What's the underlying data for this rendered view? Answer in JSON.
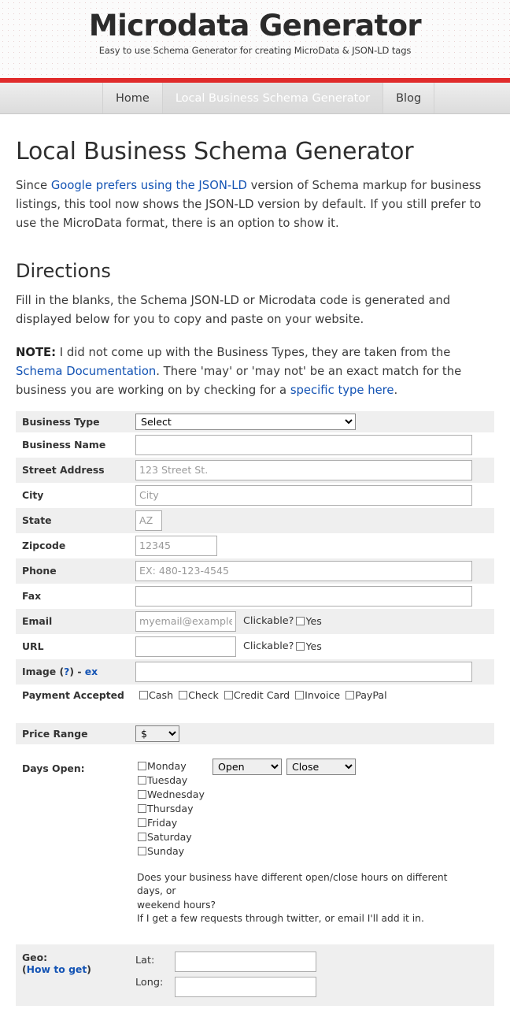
{
  "header": {
    "title": "Microdata Generator",
    "tagline": "Easy to use Schema Generator for creating MicroData & JSON-LD tags",
    "accent_color": "#e02b2b"
  },
  "nav": {
    "items": [
      {
        "label": "Home",
        "active": false
      },
      {
        "label": "Local Business Schema Generator",
        "active": true
      },
      {
        "label": "Blog",
        "active": false
      }
    ]
  },
  "page": {
    "title": "Local Business Schema Generator",
    "intro": {
      "before_link": "Since ",
      "link": "Google prefers using the JSON-LD",
      "after_link": " version of Schema markup for business listings, this tool now shows the JSON-LD version by default. If you still prefer to use the MicroData format, there is an option to show it."
    },
    "directions": {
      "heading": "Directions",
      "paragraph": "Fill in the blanks, the Schema JSON-LD or Microdata code is generated and displayed below for you to copy and paste on your website.",
      "note_label": "NOTE:",
      "note_part1": " I did not come up with the Business Types, they are taken from the ",
      "note_link1": "Schema Documentation",
      "note_part2": ". There 'may' or 'may not' be an exact match for the business you are working on by checking for a ",
      "note_link2": "specific type here",
      "note_part3": "."
    }
  },
  "form": {
    "business_type": {
      "label": "Business Type",
      "value": "Select"
    },
    "business_name": {
      "label": "Business Name",
      "value": "",
      "placeholder": ""
    },
    "street_address": {
      "label": "Street Address",
      "value": "",
      "placeholder": "123 Street St."
    },
    "city": {
      "label": "City",
      "value": "",
      "placeholder": "City"
    },
    "state": {
      "label": "State",
      "value": "",
      "placeholder": "AZ"
    },
    "zipcode": {
      "label": "Zipcode",
      "value": "",
      "placeholder": "12345"
    },
    "phone": {
      "label": "Phone",
      "value": "",
      "placeholder": "EX: 480-123-4545"
    },
    "fax": {
      "label": "Fax",
      "value": "",
      "placeholder": ""
    },
    "email": {
      "label": "Email",
      "value": "",
      "placeholder": "myemail@example.",
      "clickable_label": "Clickable?",
      "clickable_yes": "Yes"
    },
    "url": {
      "label": "URL",
      "value": "",
      "placeholder": "",
      "clickable_label": "Clickable?",
      "clickable_yes": "Yes"
    },
    "image": {
      "label_prefix": "Image (",
      "label_help": "?",
      "label_mid": ") - ",
      "label_ex": "ex",
      "value": "",
      "placeholder": ""
    },
    "payment_accepted": {
      "label": "Payment Accepted",
      "options": [
        "Cash",
        "Check",
        "Credit Card",
        "Invoice",
        "PayPal"
      ]
    },
    "price_range": {
      "label": "Price Range",
      "value": "$"
    },
    "days_open": {
      "label": "Days Open:",
      "days": [
        "Monday",
        "Tuesday",
        "Wednesday",
        "Thursday",
        "Friday",
        "Saturday",
        "Sunday"
      ],
      "open_value": "Open",
      "close_value": "Close",
      "note_line1": "Does your business have different open/close hours on different days, or",
      "note_line2": "weekend hours?",
      "note_line3": "If I get a few requests through twitter, or email I'll add it in."
    },
    "geo": {
      "label": "Geo:",
      "help_open": "(",
      "help_link": "How to get",
      "help_close": ")",
      "lat_label": "Lat:",
      "long_label": "Long:",
      "lat_value": "",
      "long_value": ""
    }
  }
}
